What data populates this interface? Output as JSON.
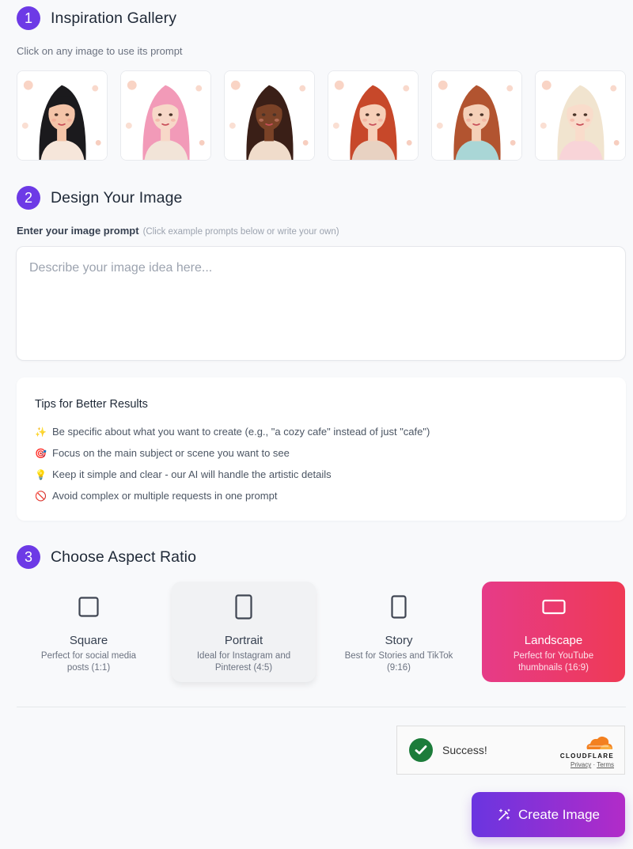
{
  "sections": {
    "gallery": {
      "step": "1",
      "title": "Inspiration Gallery",
      "subtitle": "Click on any image to use its prompt"
    },
    "design": {
      "step": "2",
      "title": "Design Your Image"
    },
    "aspect": {
      "step": "3",
      "title": "Choose Aspect Ratio"
    }
  },
  "gallery": {
    "images": [
      {
        "alt": "Woman with long black hair, green eyes and floral headband",
        "hair": "#1b1a1d",
        "skin": "#f4c4a8",
        "outfit": "#f6e6da"
      },
      {
        "alt": "Woman with pink wavy hair in embroidered blouse",
        "hair": "#f29ab8",
        "skin": "#f7d8c8",
        "outfit": "#f2e4d8"
      },
      {
        "alt": "Woman with dark curly hair and flower crown",
        "hair": "#3a1f17",
        "skin": "#7a4227",
        "outfit": "#f0dccb"
      },
      {
        "alt": "Woman with red hair in off-shoulder top",
        "hair": "#c7482a",
        "skin": "#f6cfb8",
        "outfit": "#e8d2c2"
      },
      {
        "alt": "Woman with auburn hair in floral blue blouse",
        "hair": "#b25430",
        "skin": "#f5d0b8",
        "outfit": "#a9d6d6"
      },
      {
        "alt": "Woman with platinum blonde updo in pink ruffles",
        "hair": "#f1e4cf",
        "skin": "#f9dccb",
        "outfit": "#f8d4d8"
      }
    ]
  },
  "prompt": {
    "label": "Enter your image prompt",
    "hint": "(Click example prompts below or write your own)",
    "placeholder": "Describe your image idea here...",
    "value": ""
  },
  "tips": {
    "title": "Tips for Better Results",
    "items": [
      {
        "emoji": "✨",
        "text": "Be specific about what you want to create (e.g., \"a cozy cafe\" instead of just \"cafe\")"
      },
      {
        "emoji": "🎯",
        "text": "Focus on the main subject or scene you want to see"
      },
      {
        "emoji": "💡",
        "text": "Keep it simple and clear - our AI will handle the artistic details"
      },
      {
        "emoji": "🚫",
        "text": "Avoid complex or multiple requests in one prompt"
      }
    ]
  },
  "aspect_ratios": [
    {
      "id": "square",
      "title": "Square",
      "desc": "Perfect for social media posts (1:1)",
      "selected": false
    },
    {
      "id": "portrait",
      "title": "Portrait",
      "desc": "Ideal for Instagram and Pinterest (4:5)",
      "selected": false
    },
    {
      "id": "story",
      "title": "Story",
      "desc": "Best for Stories and TikTok (9:16)",
      "selected": false
    },
    {
      "id": "landscape",
      "title": "Landscape",
      "desc": "Perfect for YouTube thumbnails (16:9)",
      "selected": true
    }
  ],
  "captcha": {
    "status": "Success!",
    "brand": "CLOUDFLARE",
    "privacy": "Privacy",
    "separator": "·",
    "terms": "Terms"
  },
  "create_button": {
    "label": "Create Image"
  },
  "colors": {
    "accent": "#6d3ae6",
    "selected_gradient": [
      "#e63b88",
      "#ef3a55"
    ],
    "create_gradient": [
      "#6a35e0",
      "#b22bc8"
    ],
    "success": "#1c7c3a",
    "cloudflare_orange": "#f38020"
  }
}
